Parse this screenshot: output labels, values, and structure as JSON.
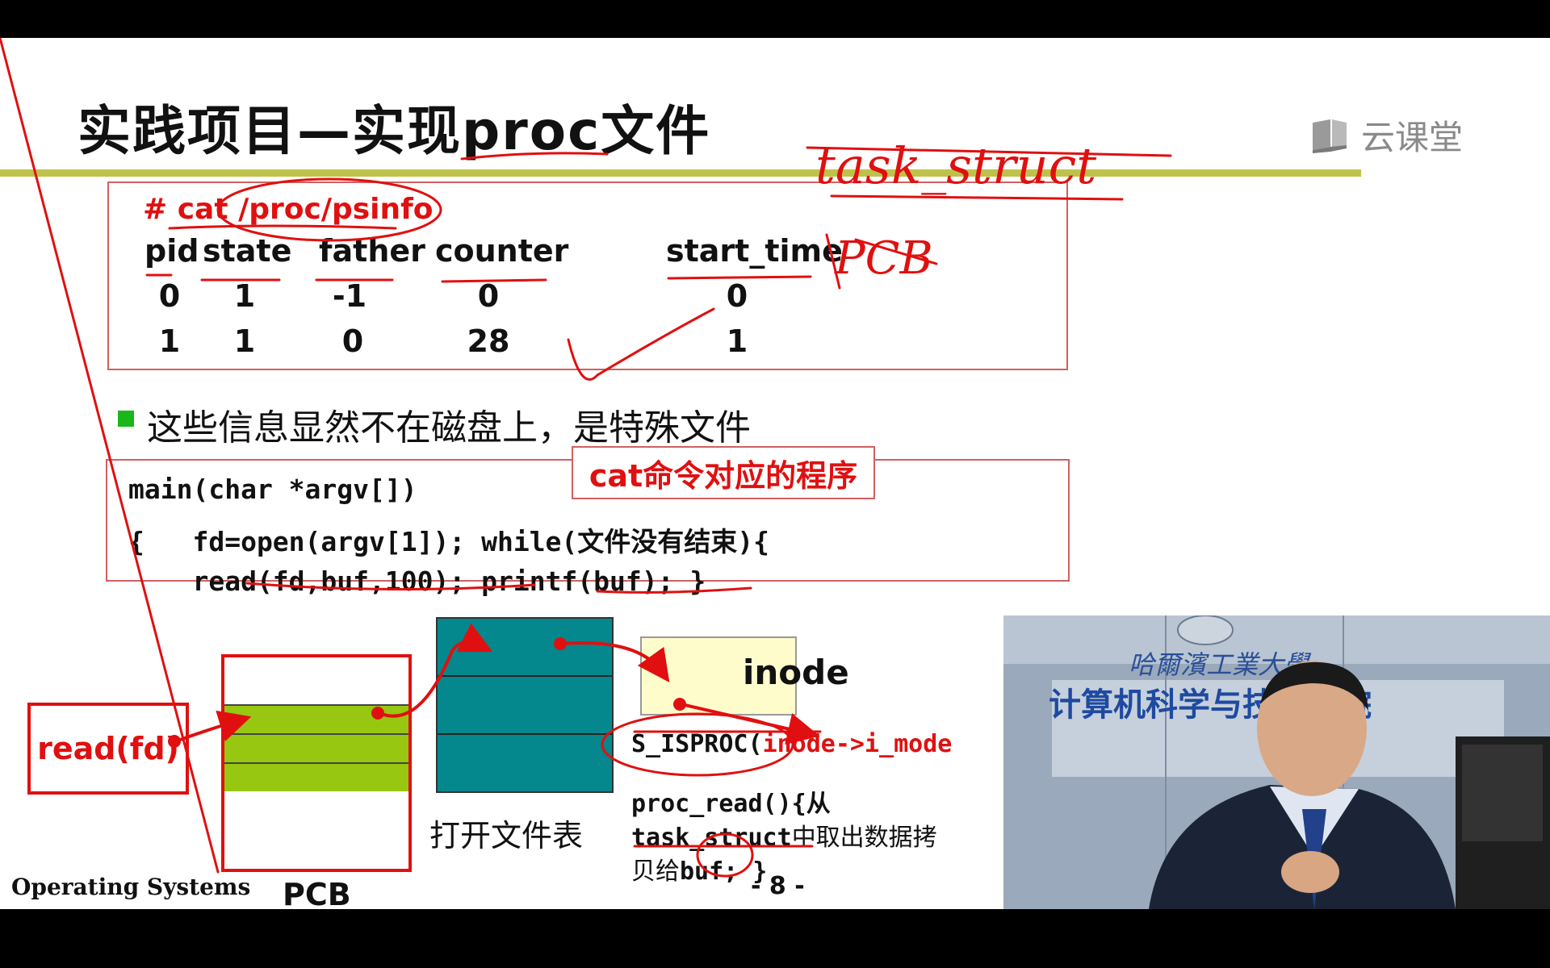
{
  "slide": {
    "title": "实践项目—实现proc文件",
    "logo_text": "云课堂",
    "command": "# cat /proc/psinfo",
    "table": {
      "headers": [
        "pid",
        "state",
        "father",
        "counter",
        "start_time"
      ],
      "rows": [
        [
          "0",
          "1",
          "-1",
          "0",
          "0"
        ],
        [
          "1",
          "1",
          "0",
          "28",
          "1"
        ]
      ]
    },
    "bullet": "这些信息显然不在磁盘上，是特殊文件",
    "cat_label": "cat命令对应的程序",
    "code_lines": [
      "main(char *argv[])",
      "{   fd=open(argv[1]); while(文件没有结束){",
      "    read(fd,buf,100); printf(buf); }"
    ],
    "diagram": {
      "read_label": "read(fd)",
      "pcb_label": "PCB",
      "file_table_label": "打开文件表",
      "inode_label": "inode",
      "isproc_prefix": "S_ISPROC(",
      "isproc_arg": "inode->i_mode",
      "proc_read_1": "proc_read(){从",
      "proc_read_2a": "task_struct",
      "proc_read_2b": "中取出数据拷",
      "proc_read_3a": "贝给",
      "proc_read_3b": "buf; }"
    },
    "footer_left": "Operating Systems",
    "page_number": "- 8 -"
  },
  "handwriting": {
    "note_1": "task_struct",
    "note_2": "PCB"
  },
  "video": {
    "banner_line1": "哈爾濱工業大學",
    "banner_line2": "计算机科学与技术学院"
  },
  "colors": {
    "accent_red": "#e01010",
    "rule_olive": "#bfc24a",
    "pcb_green": "#97c711",
    "teal": "#05878e",
    "inode_yellow": "#fffccc",
    "bullet_green": "#19b719"
  }
}
